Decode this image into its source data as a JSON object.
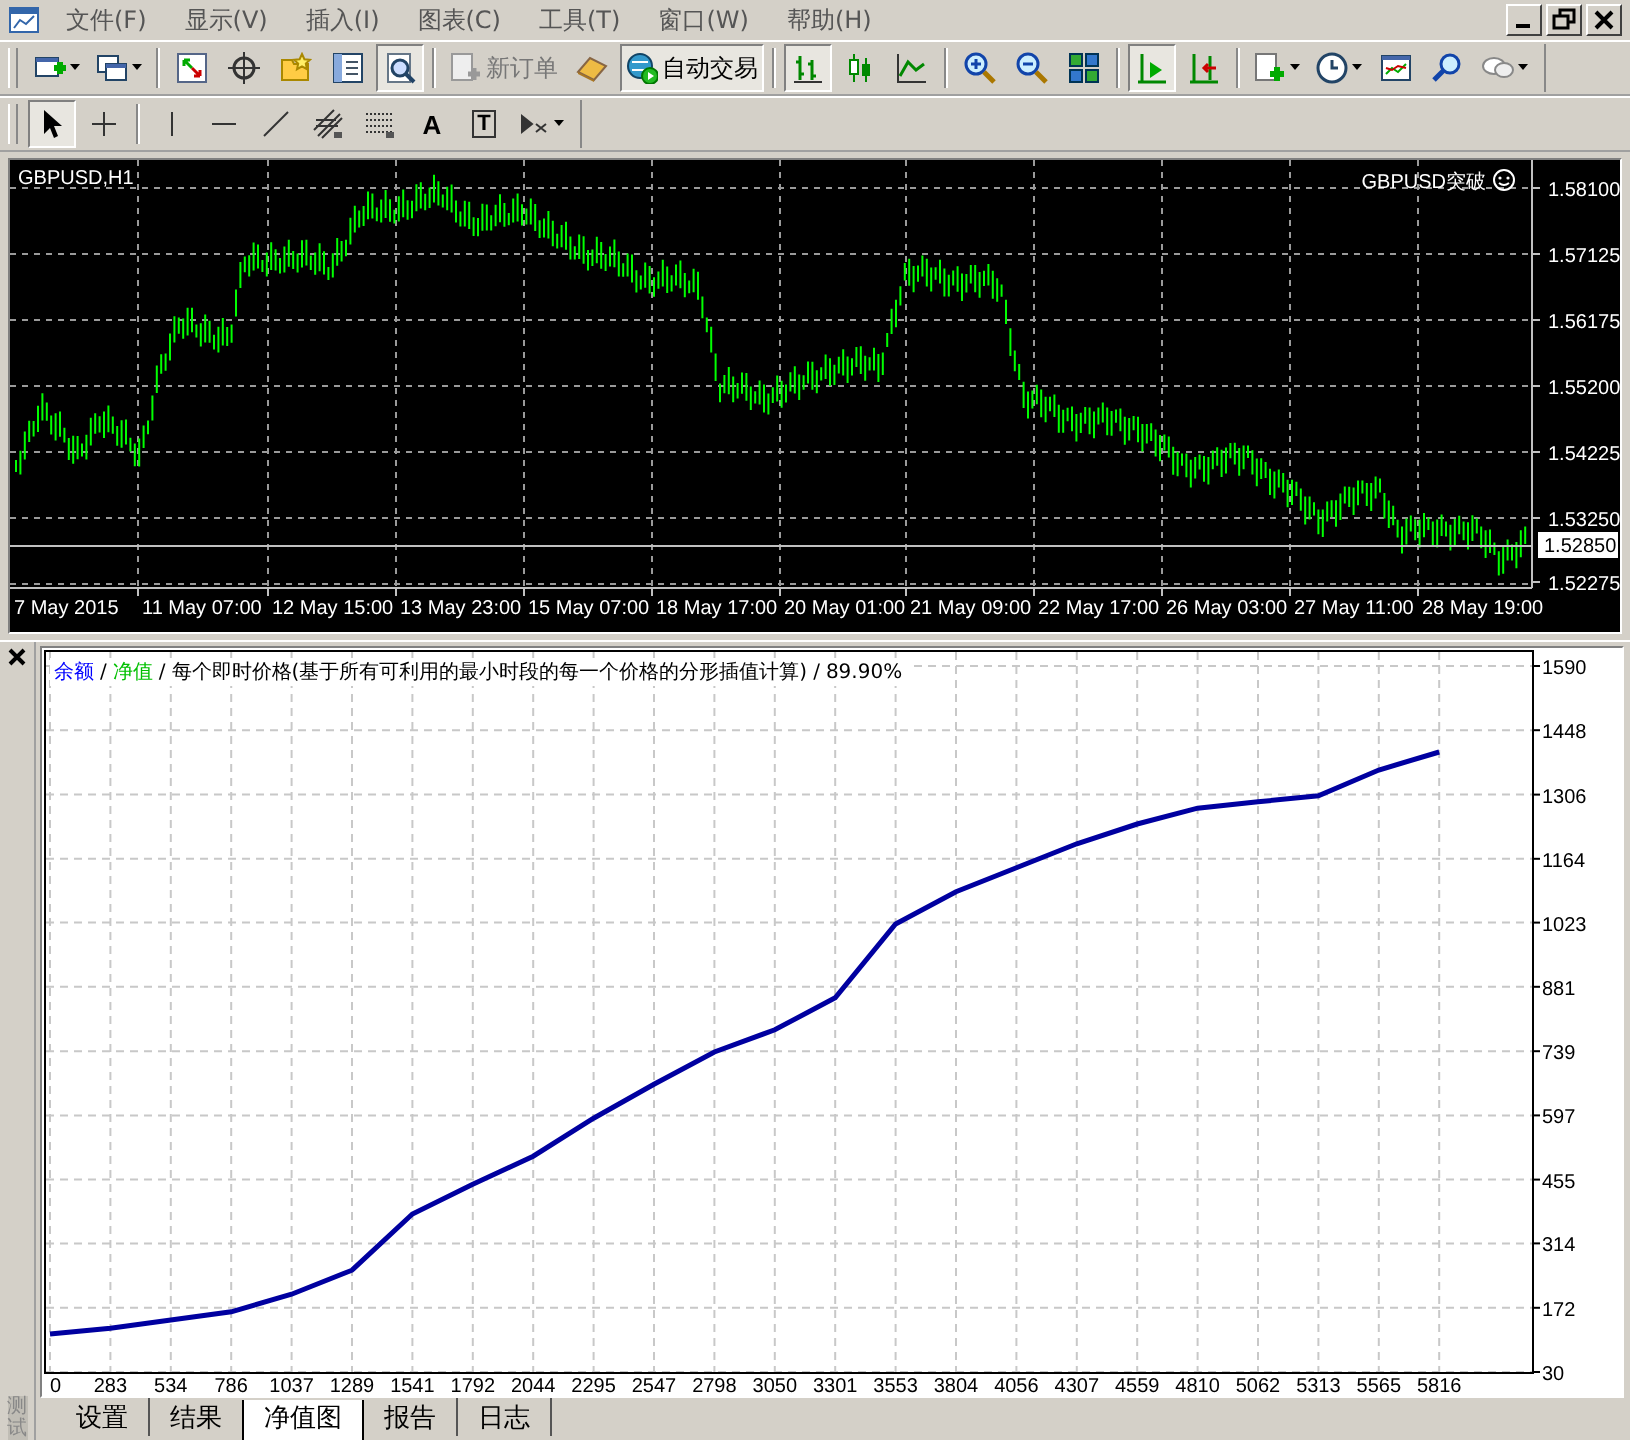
{
  "menu": {
    "items": [
      "文件(F)",
      "显示(V)",
      "插入(I)",
      "图表(C)",
      "工具(T)",
      "窗口(W)",
      "帮助(H)"
    ]
  },
  "toolbar_main": {
    "items": [
      {
        "kind": "chart-new",
        "pressed": false,
        "dropdown": true
      },
      {
        "kind": "profiles",
        "pressed": false,
        "dropdown": true
      },
      {
        "kind": "separator"
      },
      {
        "kind": "market-watch",
        "pressed": false
      },
      {
        "kind": "crosshair",
        "pressed": false
      },
      {
        "kind": "navigator",
        "pressed": false
      },
      {
        "kind": "terminal",
        "pressed": false
      },
      {
        "kind": "tester",
        "pressed": true
      },
      {
        "kind": "separator"
      },
      {
        "kind": "order",
        "pressed": false,
        "label": "新订单"
      },
      {
        "kind": "ingot",
        "pressed": false
      },
      {
        "kind": "autotrade",
        "pressed": true,
        "label": "自动交易"
      },
      {
        "kind": "separator"
      },
      {
        "kind": "bars",
        "pressed": true
      },
      {
        "kind": "candles",
        "pressed": false
      },
      {
        "kind": "line",
        "pressed": false
      },
      {
        "kind": "separator"
      },
      {
        "kind": "zoom-in",
        "pressed": false
      },
      {
        "kind": "zoom-out",
        "pressed": false
      },
      {
        "kind": "tile",
        "pressed": false
      },
      {
        "kind": "separator"
      },
      {
        "kind": "autoscroll",
        "pressed": true
      },
      {
        "kind": "shift",
        "pressed": false
      },
      {
        "kind": "separator"
      },
      {
        "kind": "indicators",
        "pressed": false,
        "dropdown": true
      },
      {
        "kind": "periods",
        "pressed": false,
        "dropdown": true
      },
      {
        "kind": "templates",
        "pressed": false
      },
      {
        "kind": "search",
        "pressed": false
      },
      {
        "kind": "chat",
        "pressed": false,
        "dropdown": true
      }
    ]
  },
  "toolbar_drawing": {
    "items": [
      {
        "kind": "cursor",
        "pressed": true
      },
      {
        "kind": "cross",
        "pressed": false
      },
      {
        "kind": "separator"
      },
      {
        "kind": "vline",
        "pressed": false
      },
      {
        "kind": "hline",
        "pressed": false
      },
      {
        "kind": "trendline",
        "pressed": false
      },
      {
        "kind": "fibo-channel",
        "pressed": false
      },
      {
        "kind": "fibo",
        "pressed": false
      },
      {
        "kind": "text",
        "pressed": false,
        "label": "A"
      },
      {
        "kind": "label",
        "pressed": false,
        "label": "T"
      },
      {
        "kind": "arrows",
        "pressed": false,
        "dropdown": true
      }
    ]
  },
  "chart": {
    "symbol": "GBPUSD,H1",
    "expert": "GBPUSD突破",
    "price_labels": [
      "1.58100",
      "1.57125",
      "1.56175",
      "1.55200",
      "1.54225",
      "1.53250",
      "1.52275"
    ],
    "current_price": "1.52850",
    "time_labels": [
      "7 May 2015",
      "11 May 07:00",
      "12 May 15:00",
      "13 May 23:00",
      "15 May 07:00",
      "18 May 17:00",
      "20 May 01:00",
      "21 May 09:00",
      "22 May 17:00",
      "26 May 03:00",
      "27 May 11:00",
      "28 May 19:00"
    ]
  },
  "tester": {
    "side_label": "测试",
    "legend": [
      {
        "text": "余额",
        "color": "#0000ff"
      },
      {
        "text": "/",
        "color": "#000000"
      },
      {
        "text": "净值",
        "color": "#00c000"
      },
      {
        "text": "/",
        "color": "#000000"
      },
      {
        "text": "每个即时价格(基于所有可利用的最小时段的每一个价格的分形插值计算)",
        "color": "#000000"
      },
      {
        "text": "/",
        "color": "#000000"
      },
      {
        "text": "89.90%",
        "color": "#000000"
      }
    ],
    "chart_data": {
      "type": "line",
      "categories": [
        "0",
        "283",
        "534",
        "786",
        "1037",
        "1289",
        "1541",
        "1792",
        "2044",
        "2295",
        "2547",
        "2798",
        "3050",
        "3301",
        "3553",
        "3804",
        "4056",
        "4307",
        "4559",
        "4810",
        "5062",
        "5313",
        "5565",
        "5816"
      ],
      "grid": true,
      "series": [
        {
          "color": "#0000a0",
          "values": [
            114,
            127,
            145,
            163,
            202,
            255,
            379,
            445,
            507,
            591,
            666,
            737,
            786,
            857,
            1020,
            1091,
            1144,
            1197,
            1241,
            1276,
            1290,
            1303,
            1360,
            1400
          ]
        }
      ],
      "ylim": [
        30,
        1590
      ],
      "yticks": [
        30,
        172,
        314,
        455,
        597,
        739,
        881,
        1023,
        1164,
        1306,
        1448,
        1590
      ]
    },
    "tabs": [
      {
        "label": "设置",
        "selected": false
      },
      {
        "label": "结果",
        "selected": false
      },
      {
        "label": "净值图",
        "selected": true
      },
      {
        "label": "报告",
        "selected": false
      },
      {
        "label": "日志",
        "selected": false
      }
    ]
  }
}
